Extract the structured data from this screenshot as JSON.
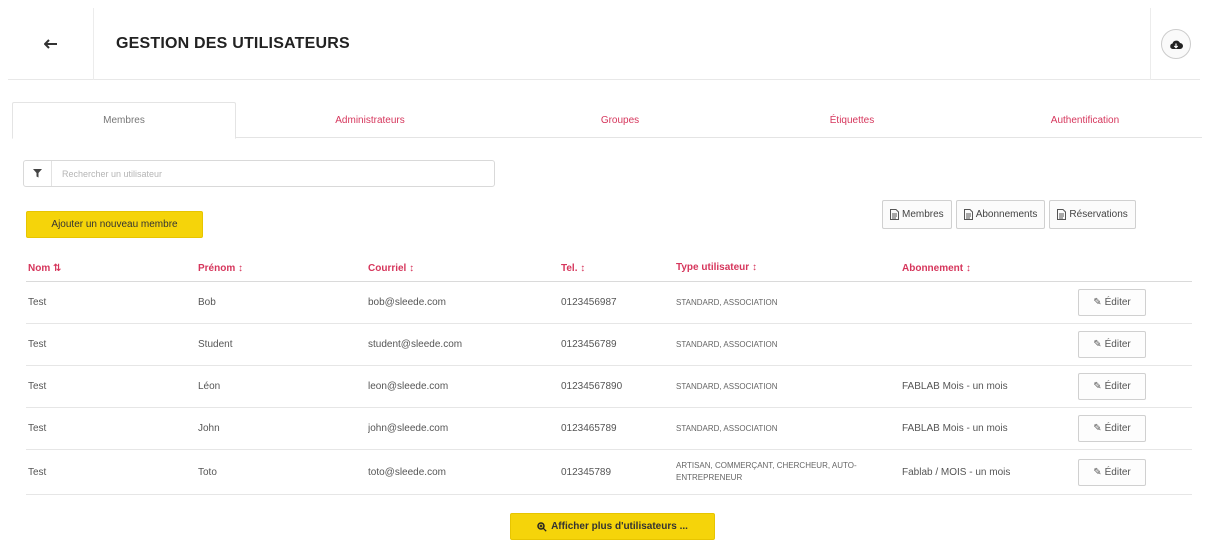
{
  "header": {
    "back_icon": "arrow-left-icon",
    "title": "GESTION DES UTILISATEURS",
    "cloud_icon": "cloud-download-icon"
  },
  "tabs": [
    {
      "label": "Membres",
      "active": true
    },
    {
      "label": "Administrateurs",
      "active": false
    },
    {
      "label": "Groupes",
      "active": false
    },
    {
      "label": "Étiquettes",
      "active": false
    },
    {
      "label": "Authentification",
      "active": false
    }
  ],
  "search": {
    "filter_icon": "filter-icon",
    "placeholder": "Rechercher un utilisateur",
    "value": ""
  },
  "actions": {
    "add_member": "Ajouter un nouveau membre",
    "export_members": "Membres",
    "export_subscriptions": "Abonnements",
    "export_reservations": "Réservations",
    "export_icon": "file-icon",
    "show_more": "Afficher plus d'utilisateurs ...",
    "show_more_icon": "search-plus-icon"
  },
  "table": {
    "columns": {
      "nom": "Nom",
      "prenom": "Prénom",
      "courriel": "Courriel",
      "tel": "Tel.",
      "type": "Type utilisateur",
      "abonnement": "Abonnement"
    },
    "sort_icon": "sort-icon",
    "edit_label": "Éditer",
    "edit_icon": "edit-icon",
    "rows": [
      {
        "nom": "Test",
        "prenom": "Bob",
        "courriel": "bob@sleede.com",
        "tel": "0123456987",
        "type": "STANDARD, ASSOCIATION",
        "abonnement": ""
      },
      {
        "nom": "Test",
        "prenom": "Student",
        "courriel": "student@sleede.com",
        "tel": "0123456789",
        "type": "STANDARD, ASSOCIATION",
        "abonnement": ""
      },
      {
        "nom": "Test",
        "prenom": "Léon",
        "courriel": "leon@sleede.com",
        "tel": "01234567890",
        "type": "STANDARD, ASSOCIATION",
        "abonnement": "FABLAB Mois - un mois"
      },
      {
        "nom": "Test",
        "prenom": "John",
        "courriel": "john@sleede.com",
        "tel": "0123465789",
        "type": "STANDARD, ASSOCIATION",
        "abonnement": "FABLAB Mois - un mois"
      },
      {
        "nom": "Test",
        "prenom": "Toto",
        "courriel": "toto@sleede.com",
        "tel": "012345789",
        "type": "ARTISAN, COMMERÇANT, CHERCHEUR, AUTO-ENTREPRENEUR",
        "abonnement": "Fablab / MOIS - un mois"
      }
    ]
  },
  "colors": {
    "accent": "#d6365c",
    "primary_button": "#f5d40a"
  }
}
